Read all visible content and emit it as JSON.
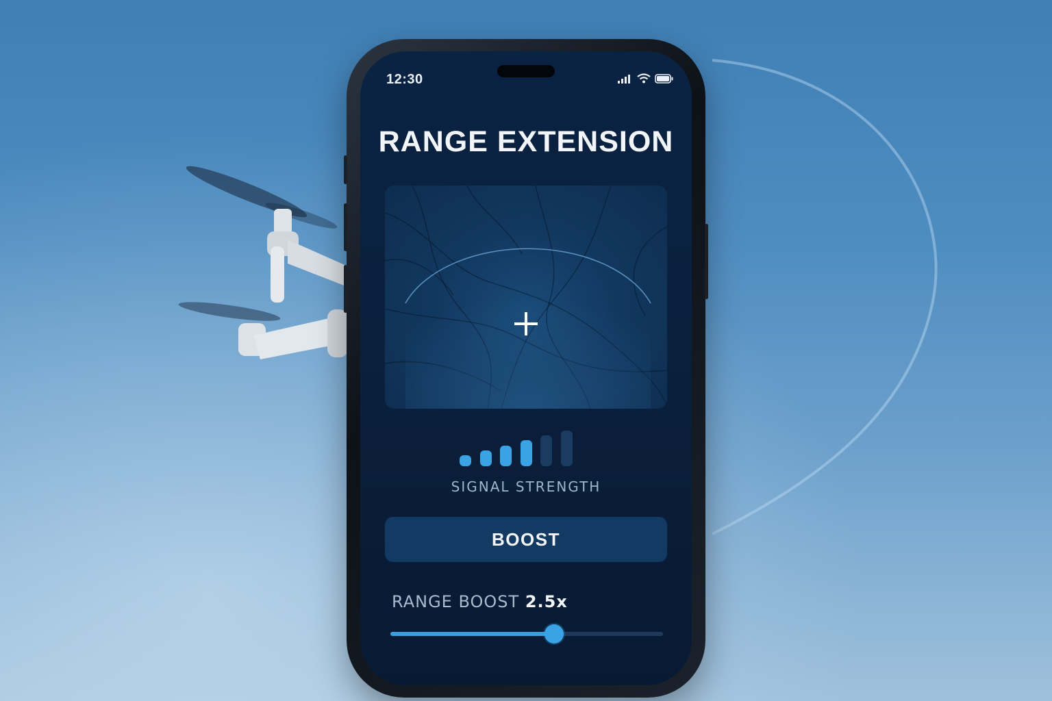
{
  "status_bar": {
    "time": "12:30",
    "icons": [
      "cellular-signal-icon",
      "wifi-icon",
      "battery-icon"
    ]
  },
  "screen": {
    "title": "RANGE EXTENSION",
    "map": {
      "center_icon": "crosshair-plus-icon"
    },
    "signal": {
      "label": "SIGNAL STRENGTH",
      "bars_total": 6,
      "bars_active": 4
    },
    "boost_button": {
      "label": "BOOST"
    },
    "range_boost": {
      "label": "RANGE BOOST",
      "value": "2.5x",
      "slider_fraction": 0.6
    }
  },
  "colors": {
    "accent": "#3aa3e6",
    "screen_bg": "#0a2342",
    "button_bg": "#123a62",
    "inactive_bar": "#1a3c60"
  }
}
